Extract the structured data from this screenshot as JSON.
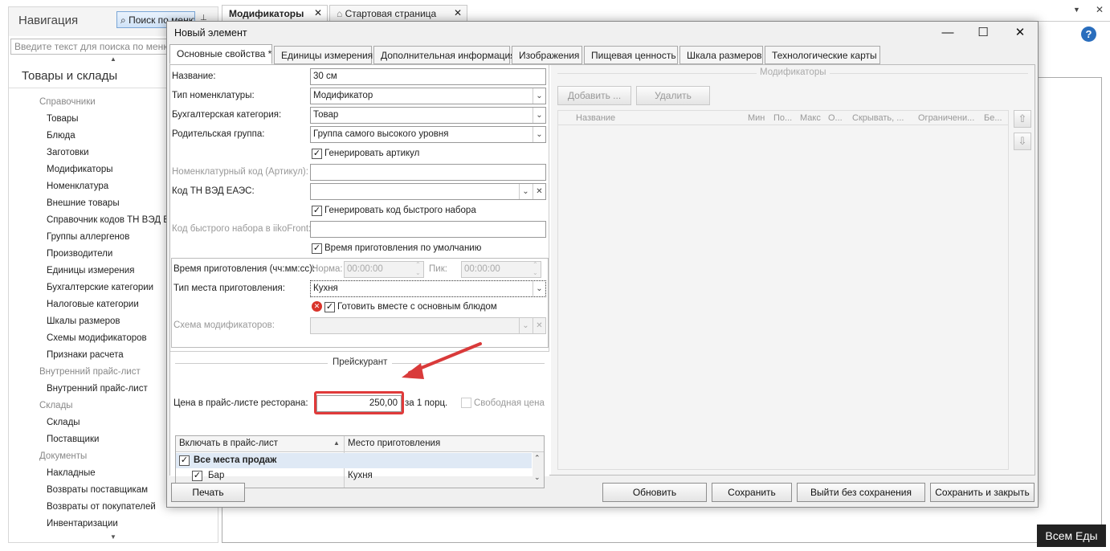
{
  "nav": {
    "title": "Навигация",
    "search_button": "Поиск по меню",
    "search_placeholder": "Введите текст для поиска по меню...",
    "section": "Товары и склады",
    "items": [
      {
        "type": "group",
        "label": "Справочники"
      },
      {
        "type": "item",
        "label": "Товары"
      },
      {
        "type": "item",
        "label": "Блюда"
      },
      {
        "type": "item",
        "label": "Заготовки"
      },
      {
        "type": "item",
        "label": "Модификаторы"
      },
      {
        "type": "item",
        "label": "Номенклатура"
      },
      {
        "type": "item",
        "label": "Внешние товары"
      },
      {
        "type": "item",
        "label": "Справочник кодов ТН ВЭД ЕА"
      },
      {
        "type": "item",
        "label": "Группы аллергенов"
      },
      {
        "type": "item",
        "label": "Производители"
      },
      {
        "type": "item",
        "label": "Единицы измерения"
      },
      {
        "type": "item",
        "label": "Бухгалтерские категории"
      },
      {
        "type": "item",
        "label": "Налоговые категории"
      },
      {
        "type": "item",
        "label": "Шкалы размеров"
      },
      {
        "type": "item",
        "label": "Схемы модификаторов"
      },
      {
        "type": "item",
        "label": "Признаки расчета"
      },
      {
        "type": "group",
        "label": "Внутренний прайс-лист"
      },
      {
        "type": "item",
        "label": "Внутренний прайс-лист"
      },
      {
        "type": "group",
        "label": "Склады"
      },
      {
        "type": "item",
        "label": "Склады"
      },
      {
        "type": "item",
        "label": "Поставщики"
      },
      {
        "type": "group",
        "label": "Документы"
      },
      {
        "type": "item",
        "label": "Накладные"
      },
      {
        "type": "item",
        "label": "Возвраты поставщикам"
      },
      {
        "type": "item",
        "label": "Возвраты от покупателей"
      },
      {
        "type": "item",
        "label": "Инвентаризации"
      }
    ]
  },
  "top_tabs": [
    "Модификаторы",
    "Стартовая страница"
  ],
  "dialog": {
    "title": "Новый элемент",
    "tabs": [
      "Основные свойства *",
      "Единицы измерения",
      "Дополнительная информация",
      "Изображения",
      "Пищевая ценность",
      "Шкала размеров",
      "Технологические карты"
    ],
    "form": {
      "name_label": "Название:",
      "name_value": "30 см",
      "type_label": "Тип номенклатуры:",
      "type_value": "Модификатор",
      "acc_label": "Бухгалтерская категория:",
      "acc_value": "Товар",
      "parent_label": "Родительская группа:",
      "parent_value": "Группа самого высокого уровня",
      "gen_article": "Генерировать артикул",
      "article_label": "Номенклатурный код (Артикул):",
      "tnved_label": "Код ТН ВЭД ЕАЭС:",
      "gen_quick": "Генерировать код быстрого набора",
      "quick_label": "Код быстрого набора в iikoFront:",
      "default_time": "Время приготовления по умолчанию",
      "cook_time_label": "Время приготовления (чч:мм:сс):",
      "norm_label": "Норма:",
      "norm_value": "00:00:00",
      "peak_label": "Пик:",
      "peak_value": "00:00:00",
      "place_label": "Тип места приготовления:",
      "place_value": "Кухня",
      "cook_together": "Готовить вместе с основным блюдом",
      "scheme_label": "Схема модификаторов:"
    },
    "price": {
      "section": "Прейскурант",
      "label": "Цена в прайс-листе ресторана:",
      "value": "250,00",
      "per": "за 1 порц.",
      "free_price": "Свободная цена",
      "col1": "Включать в прайс-лист",
      "col2": "Место приготовления",
      "rows": [
        {
          "name": "Все места продаж",
          "place": ""
        },
        {
          "name": "Бар",
          "place": "Кухня"
        }
      ]
    },
    "modifiers": {
      "title": "Модификаторы",
      "add": "Добавить ...",
      "delete": "Удалить",
      "columns": [
        "Название",
        "Мин",
        "По...",
        "Макс",
        "О...",
        "Скрывать, ...",
        "Ограничени...",
        "Бе..."
      ]
    },
    "buttons": {
      "print": "Печать",
      "refresh": "Обновить",
      "save": "Сохранить",
      "exit": "Выйти без сохранения",
      "save_close": "Сохранить и закрыть"
    }
  },
  "watermark": "Всем Еды"
}
